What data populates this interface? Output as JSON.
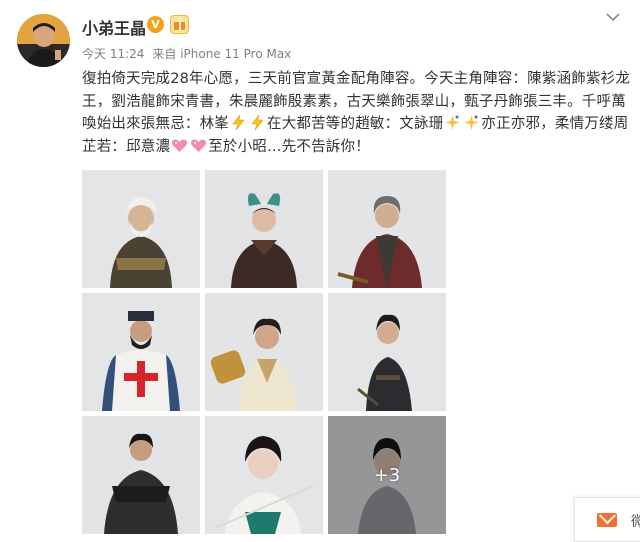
{
  "post": {
    "author": {
      "name": "小弟王晶",
      "verified_badge": "V",
      "avatar_icon": "user-avatar"
    },
    "meta": {
      "time": "今天 11:24",
      "source": "来自 iPhone 11 Pro Max"
    },
    "text_segments": [
      "復拍倚天完成28年心愿，三天前官宣黃金配角陣容。今天主角陣容：陳紫涵飾紫衫龙王，劉浩龍飾宋青書，朱晨麗飾殷素素，古天樂飾張翠山，甄子丹飾張三丰。千呼萬喚始出來張無忌：林峯",
      "在大都苦等的趙敏：文詠珊",
      "亦正亦邪，柔情万缕周芷若：邱意濃",
      "至於小昭…先不告訴你！"
    ],
    "emoji": [
      "lightning-emoji",
      "sparkle-emoji",
      "hearts-emoji"
    ],
    "photos": {
      "count_visible": 9,
      "more_label": "+3"
    }
  },
  "ui": {
    "more_menu_icon": "chevron-down-icon",
    "floating_widget_label": "微"
  },
  "colors": {
    "text": "#333333",
    "meta": "#808080",
    "verified": "#f4a21a",
    "mail_accent": "#f46f2d"
  }
}
